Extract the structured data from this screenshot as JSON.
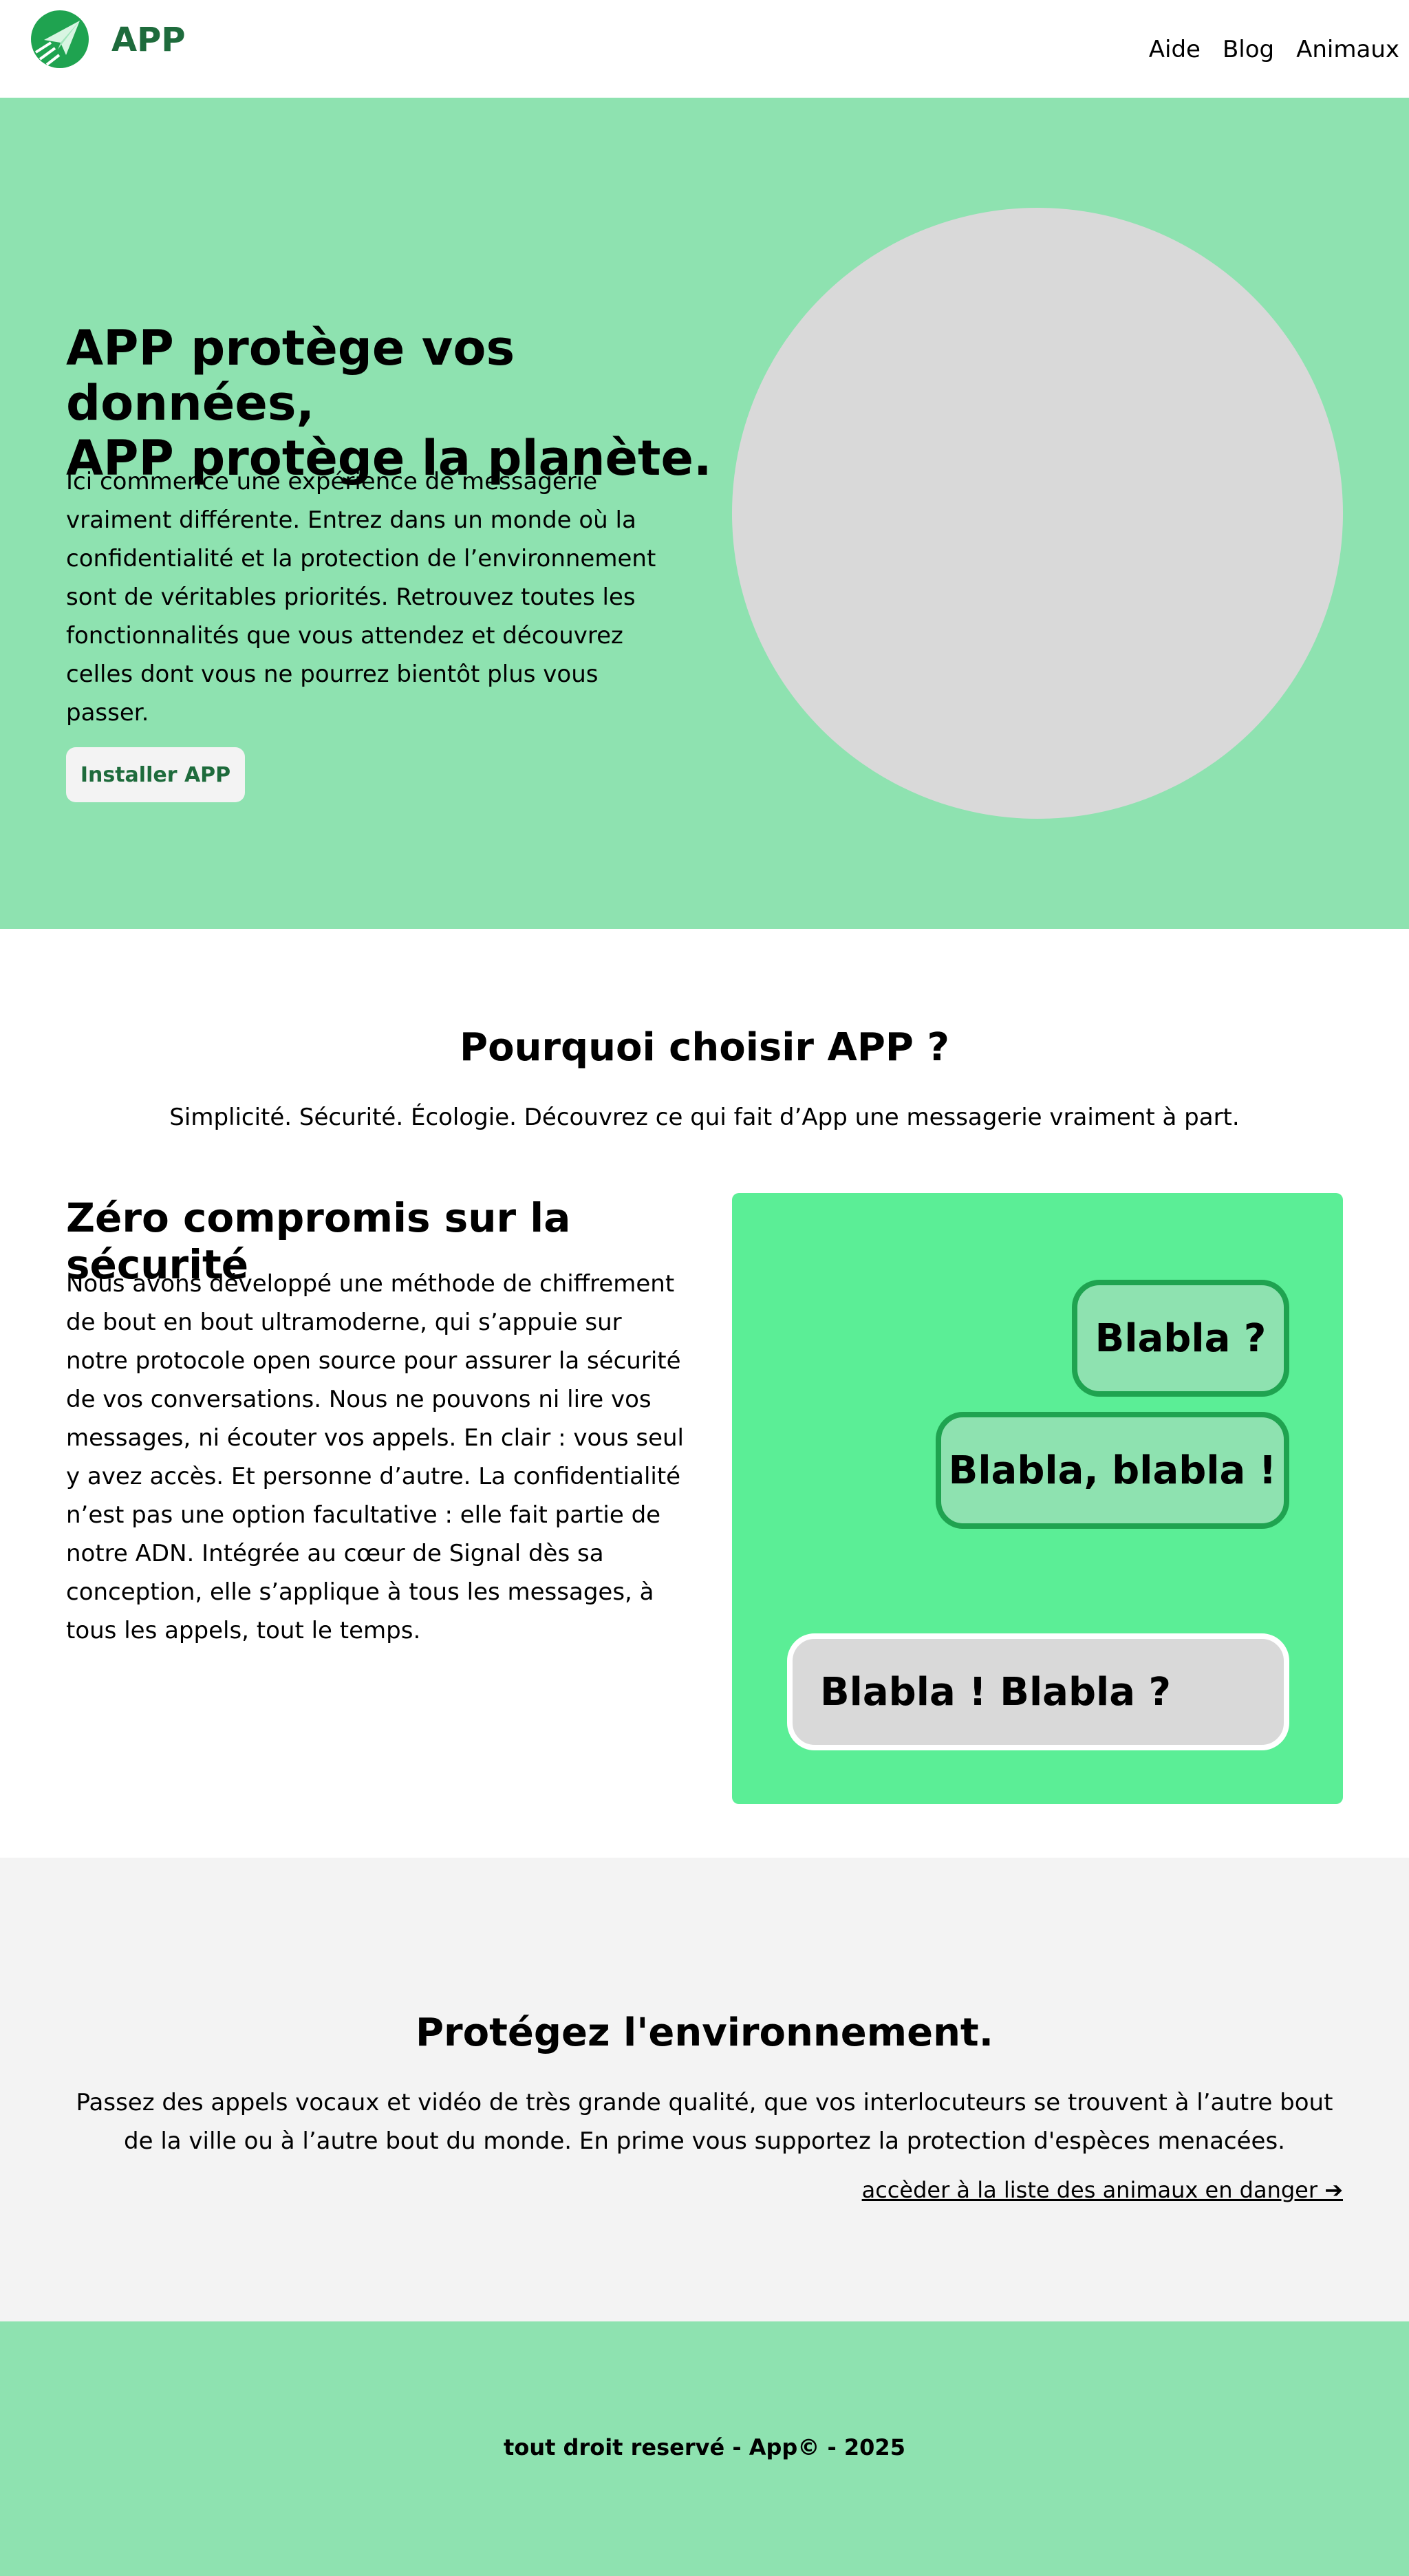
{
  "header": {
    "brand": "APP",
    "logo_icon": "paper-plane-icon",
    "nav": [
      "Aide",
      "Blog",
      "Animaux"
    ]
  },
  "hero": {
    "title_line1": "APP protège vos données,",
    "title_line2": "APP protège la planète.",
    "text": "Ici commence une expérience de messagerie vraiment différente. Entrez dans un monde où la confidentialité et la protection de l’environnement sont de véritables priorités. Retrouvez toutes les fonctionnalités que vous attendez et découvrez celles dont vous ne pourrez bientôt plus vous passer.",
    "button": "Installer APP"
  },
  "why": {
    "title": "Pourquoi choisir APP ?",
    "subtitle": "Simplicité. Sécurité. Écologie. Découvrez ce qui fait d’App une messagerie vraiment à part.",
    "security_title": "Zéro compromis sur la sécurité",
    "security_text": "Nous avons développé une méthode de chiffrement de bout en bout ultramoderne, qui s’appuie sur notre protocole open source pour assurer la sécurité de vos conversations. Nous ne pouvons ni lire vos messages, ni écouter vos appels. En clair : vous seul y avez accès. Et personne d’autre. La confidentialité n’est pas une option facultative : elle fait partie de notre ADN. Intégrée au cœur de Signal dès sa conception, elle s’applique à tous les messages, à tous les appels, tout le temps.",
    "bubbles": [
      "Blabla ?",
      "Blabla, blabla !",
      "Blabla ! Blabla ?"
    ]
  },
  "environment": {
    "title": "Protégez l'environnement.",
    "text": "Passez des appels vocaux et vidéo de très grande qualité, que vos interlocuteurs se trouvent à l’autre bout de la ville ou à l’autre bout du monde. En prime vous supportez la protection d'espèces menacées.",
    "link": "accèder à la liste des animaux en danger ➔"
  },
  "footer": {
    "text": "tout droit reservé - App© - 2025"
  },
  "colors": {
    "mint": "#8ee2b0",
    "bright_green": "#5bee96",
    "dark_green": "#1e6b3c",
    "bubble_border": "#1fa350",
    "light_gray": "#f3f3f3",
    "placeholder_gray": "#d9d9d9"
  }
}
